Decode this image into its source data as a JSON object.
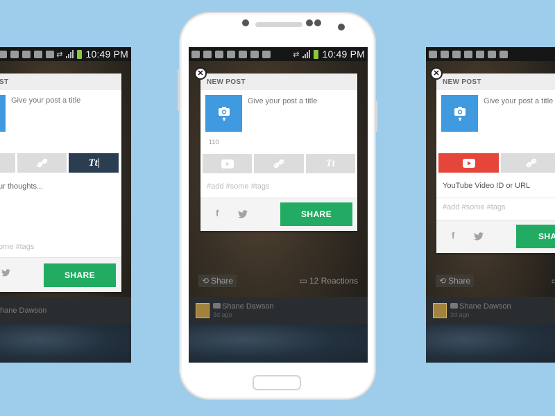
{
  "statusbar": {
    "time": "10:49 PM",
    "battery_color": "#8dc63f"
  },
  "dialog": {
    "header_title": "NEW POST",
    "header_title_partial": "ST",
    "title_placeholder": "Give your post a title",
    "char_count": "110",
    "tags_placeholder": "#add #some #tags",
    "tags_placeholder_partial": "ome #tags",
    "share_label": "SHARE",
    "video_url_placeholder": "YouTube Video ID or URL",
    "thoughts_placeholder_partial": "ur thoughts...",
    "type_buttons": [
      {
        "name": "video",
        "icon": "play-icon"
      },
      {
        "name": "link",
        "icon": "link-icon"
      },
      {
        "name": "text",
        "icon": "text-icon",
        "label": "Tt"
      }
    ],
    "social": {
      "facebook": "f",
      "twitter": "twitter-bird"
    }
  },
  "feed": {
    "share_label": "Share",
    "reactions_label": "12 Reactions",
    "user_name": "Shane Dawson",
    "user_name_partial": "hane Dawson",
    "time_ago": "3d ago"
  },
  "colors": {
    "background": "#9dcdea",
    "camera_button": "#3f9ae0",
    "share_button": "#22ac63",
    "video_active": "#e6453a",
    "text_active": "#2b3d51"
  }
}
